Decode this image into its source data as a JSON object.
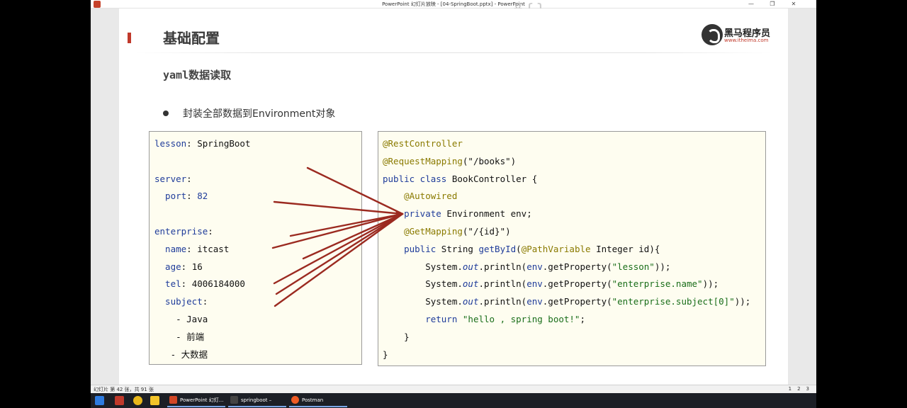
{
  "window": {
    "title": "PowerPoint 幻灯片放映 - [04-SpringBoot.pptx] - PowerPoint",
    "minimize": "—",
    "maximize": "❐",
    "close": "✕"
  },
  "slide": {
    "title": "基础配置",
    "logo_name": "黑马程序员",
    "logo_url": "www.itheima.com",
    "subtitle": "yaml数据读取",
    "bullet": "封装全部数据到Environment对象",
    "deco": "¥{}"
  },
  "yaml_lines": [
    [
      {
        "t": "lesson",
        "c": "k"
      },
      {
        "t": ": SpringBoot",
        "c": ""
      }
    ],
    [],
    [
      {
        "t": "server",
        "c": "k"
      },
      {
        "t": ":",
        "c": ""
      }
    ],
    [
      {
        "t": "  port",
        "c": "k"
      },
      {
        "t": ": ",
        "c": ""
      },
      {
        "t": "82",
        "c": "num"
      }
    ],
    [],
    [
      {
        "t": "enterprise",
        "c": "k"
      },
      {
        "t": ":",
        "c": ""
      }
    ],
    [
      {
        "t": "  name",
        "c": "k"
      },
      {
        "t": ": itcast",
        "c": ""
      }
    ],
    [
      {
        "t": "  age",
        "c": "k"
      },
      {
        "t": ": 16",
        "c": ""
      }
    ],
    [
      {
        "t": "  tel",
        "c": "k"
      },
      {
        "t": ": 4006184000",
        "c": ""
      }
    ],
    [
      {
        "t": "  subject",
        "c": "k"
      },
      {
        "t": ":",
        "c": ""
      }
    ],
    [
      {
        "t": "    - Java",
        "c": ""
      }
    ],
    [
      {
        "t": "    - 前端",
        "c": ""
      }
    ],
    [
      {
        "t": "   - 大数据",
        "c": ""
      }
    ]
  ],
  "java_lines": [
    [
      {
        "t": "@RestController",
        "c": "ann"
      }
    ],
    [
      {
        "t": "@RequestMapping",
        "c": "ann"
      },
      {
        "t": "(\"/books\")",
        "c": ""
      }
    ],
    [
      {
        "t": "public class ",
        "c": "kw"
      },
      {
        "t": "BookController {",
        "c": ""
      }
    ],
    [
      {
        "t": "    @Autowired",
        "c": "ann"
      }
    ],
    [
      {
        "t": "    private ",
        "c": "kw"
      },
      {
        "t": "Environment env;",
        "c": ""
      }
    ],
    [
      {
        "t": "    @GetMapping",
        "c": "ann"
      },
      {
        "t": "(\"/{id}\")",
        "c": ""
      }
    ],
    [
      {
        "t": "    public ",
        "c": "kw"
      },
      {
        "t": "String ",
        "c": ""
      },
      {
        "t": "getById",
        "c": "k"
      },
      {
        "t": "(",
        "c": ""
      },
      {
        "t": "@PathVariable",
        "c": "ann"
      },
      {
        "t": " Integer id){",
        "c": ""
      }
    ],
    [
      {
        "t": "        System.",
        "c": ""
      },
      {
        "t": "out",
        "c": "it"
      },
      {
        "t": ".println(",
        "c": ""
      },
      {
        "t": "env",
        "c": "k"
      },
      {
        "t": ".getProperty(",
        "c": ""
      },
      {
        "t": "\"lesson\"",
        "c": "str"
      },
      {
        "t": "));",
        "c": ""
      }
    ],
    [
      {
        "t": "        System.",
        "c": ""
      },
      {
        "t": "out",
        "c": "it"
      },
      {
        "t": ".println(",
        "c": ""
      },
      {
        "t": "env",
        "c": "k"
      },
      {
        "t": ".getProperty(",
        "c": ""
      },
      {
        "t": "\"enterprise.name\"",
        "c": "str"
      },
      {
        "t": "));",
        "c": ""
      }
    ],
    [
      {
        "t": "        System.",
        "c": ""
      },
      {
        "t": "out",
        "c": "it"
      },
      {
        "t": ".println(",
        "c": ""
      },
      {
        "t": "env",
        "c": "k"
      },
      {
        "t": ".getProperty(",
        "c": ""
      },
      {
        "t": "\"enterprise.subject[0]\"",
        "c": "str"
      },
      {
        "t": "));",
        "c": ""
      }
    ],
    [
      {
        "t": "        return ",
        "c": "kw"
      },
      {
        "t": "\"hello , spring boot!\"",
        "c": "str"
      },
      {
        "t": ";",
        "c": ""
      }
    ],
    [
      {
        "t": "    }",
        "c": ""
      }
    ],
    [
      {
        "t": "}",
        "c": ""
      }
    ]
  ],
  "statusbar": {
    "left": "幻灯片 第 42 张，共 91 张",
    "right": [
      "1",
      "2",
      "3"
    ]
  },
  "taskbar": {
    "apps": [
      {
        "label": "PowerPoint 幻灯...",
        "color": "#d24726"
      },
      {
        "label": "springboot – app...",
        "color": "#1e1e1e"
      },
      {
        "label": "Postman",
        "color": "#ef5b25"
      }
    ]
  },
  "colors": {
    "accent": "#c0392b",
    "arrow": "#9b2a20",
    "codebox_bg": "#fefdf0"
  }
}
